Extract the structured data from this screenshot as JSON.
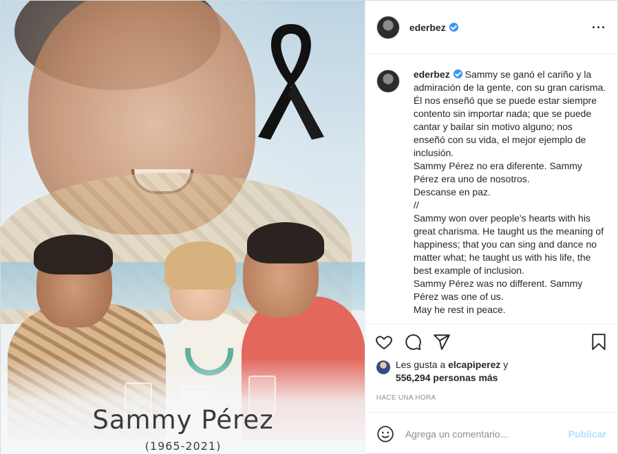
{
  "colors": {
    "accent": "#3897f0",
    "publish_disabled": "#b2dffc",
    "muted": "#8e8e8e"
  },
  "image": {
    "name_text": "Sammy Pérez",
    "years_text": "(1965-2021)"
  },
  "header": {
    "username": "ederbez",
    "verified": true,
    "more_icon": "more-horizontal-icon"
  },
  "caption": {
    "username": "ederbez",
    "text": " Sammy se ganó el cariño y la admiración de la gente, con su gran carisma. Él nos enseñó que se puede estar siempre contento sin importar nada; que se puede cantar y bailar sin motivo alguno; nos enseñó con su vida, el mejor ejemplo de inclusión.\nSammy Pérez no era diferente. Sammy Pérez era uno de nosotros.\nDescanse en paz.\n//\nSammy won over people's hearts with his great charisma. He taught us the meaning of happiness; that you can sing and dance no matter what; he taught us with his life, the best example of inclusion.\nSammy Pérez was no different. Sammy Pérez was one of us.\nMay he rest in peace."
  },
  "actions": {
    "like_icon": "heart-icon",
    "comment_icon": "comment-icon",
    "share_icon": "share-icon",
    "save_icon": "bookmark-icon"
  },
  "likes": {
    "prefix": "Les gusta a ",
    "user": "elcapiperez",
    "middle": " y",
    "count": "556,294 personas más"
  },
  "timestamp": "HACE UNA HORA",
  "comment_box": {
    "emoji_icon": "emoji-icon",
    "placeholder": "Agrega un comentario...",
    "publish_label": "Publicar"
  }
}
